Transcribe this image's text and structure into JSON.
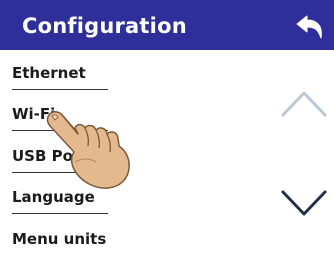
{
  "header": {
    "title": "Configuration",
    "back_icon": "back-arrow-icon",
    "background_color": "#2f2f9c"
  },
  "menu": {
    "items": [
      {
        "label": "Ethernet"
      },
      {
        "label": "Wi-Fi"
      },
      {
        "label": "USB Po"
      },
      {
        "label": "Language"
      },
      {
        "label": "Menu units"
      }
    ]
  },
  "scroll": {
    "up_icon": "chevron-up-icon",
    "down_icon": "chevron-down-icon",
    "up_color": "#b9c7d7",
    "down_color": "#22314a"
  },
  "overlay": {
    "hand_icon": "pointing-hand-icon",
    "skin_color": "#e3b98d"
  }
}
